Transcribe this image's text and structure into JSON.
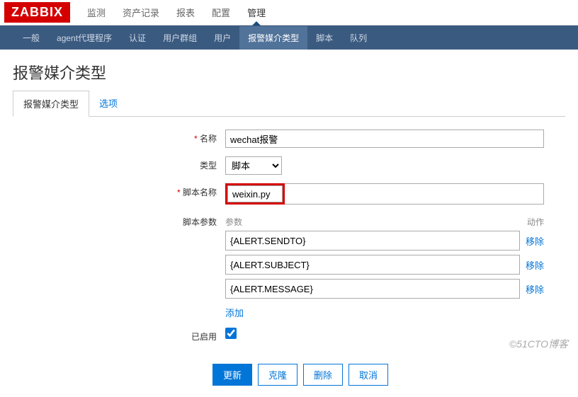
{
  "logo": "ZABBIX",
  "topnav": {
    "items": [
      "监测",
      "资产记录",
      "报表",
      "配置",
      "管理"
    ],
    "activeIndex": 4
  },
  "subnav": {
    "items": [
      "一般",
      "agent代理程序",
      "认证",
      "用户群组",
      "用户",
      "报警媒介类型",
      "脚本",
      "队列"
    ],
    "activeIndex": 5
  },
  "pageTitle": "报警媒介类型",
  "tabs": {
    "items": [
      "报警媒介类型",
      "选项"
    ],
    "activeIndex": 0
  },
  "form": {
    "nameLabel": "名称",
    "nameValue": "wechat报警",
    "typeLabel": "类型",
    "typeValue": "脚本",
    "scriptNameLabel": "脚本名称",
    "scriptNameValue": "weixin.py",
    "paramsLabel": "脚本参数",
    "paramsHeader": "参数",
    "actionsHeader": "动作",
    "params": [
      {
        "value": "{ALERT.SENDTO}",
        "remove": "移除"
      },
      {
        "value": "{ALERT.SUBJECT}",
        "remove": "移除"
      },
      {
        "value": "{ALERT.MESSAGE}",
        "remove": "移除"
      }
    ],
    "addLabel": "添加",
    "enabledLabel": "已启用",
    "enabledChecked": true
  },
  "buttons": {
    "update": "更新",
    "clone": "克隆",
    "delete": "删除",
    "cancel": "取消"
  },
  "watermark": "©51CTO博客"
}
